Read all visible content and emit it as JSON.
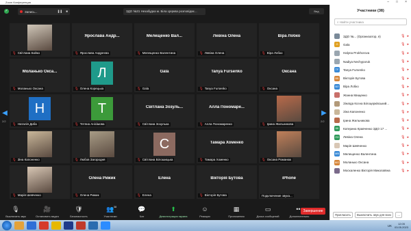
{
  "window": {
    "title": "Zoom Конференция"
  },
  "recording": {
    "label": "Запись...",
    "pause": "❚❚",
    "stop": "■"
  },
  "meeting_title": "ЗДО №31 Незабудка м. Біла Церква розповідає...",
  "view_label": "Вид",
  "pager": {
    "left_page": "2/2",
    "right_page": "2/2"
  },
  "tiles": [
    {
      "name": "",
      "label": "Світлана Бойко",
      "kind": "photo",
      "color": "#cfc6b8"
    },
    {
      "name": "Ярослава Андр...",
      "label": "Ярослава Андреєва",
      "kind": "name"
    },
    {
      "name": "Мелещенко Вал...",
      "label": "Мелещенко Валентина",
      "kind": "name"
    },
    {
      "name": "Левіна Олена",
      "label": "Левіна Олена",
      "kind": "name"
    },
    {
      "name": "Віра Лобко",
      "label": "Віра Лобко",
      "kind": "name"
    },
    {
      "name": "Моланько Окса...",
      "label": "Моланько Оксана",
      "kind": "name"
    },
    {
      "name": "",
      "label": "Олена Корецька",
      "kind": "avatar",
      "letter": "Л",
      "color": "#1f9a8a"
    },
    {
      "name": "Gala",
      "label": "Gala",
      "kind": "name"
    },
    {
      "name": "Tanya Fursenko",
      "label": "Tanya Fursenko",
      "kind": "name"
    },
    {
      "name": "Оксана",
      "label": "Оксана",
      "kind": "name"
    },
    {
      "name": "",
      "label": "Наталія Диба",
      "kind": "avatar",
      "letter": "Н",
      "color": "#1f6fc4"
    },
    {
      "name": "",
      "label": "Тетяна Анісімова",
      "kind": "avatar",
      "letter": "Т",
      "color": "#3c9a3a"
    },
    {
      "name": "Світлана Зозуль...",
      "label": "Світлана Зозулька",
      "kind": "name"
    },
    {
      "name": "Алла Пономаре...",
      "label": "Алла Пономаренко",
      "kind": "name"
    },
    {
      "name": "",
      "label": "Ірина Жильникова",
      "kind": "photo",
      "color": "#b86a4a"
    },
    {
      "name": "",
      "label": "Зіна Капоненко",
      "kind": "photo",
      "color": "#c9b79a"
    },
    {
      "name": "",
      "label": "Любов Загородня",
      "kind": "photo",
      "color": "#a89c86"
    },
    {
      "name": "",
      "label": "Світлана Білошицька",
      "kind": "avatar",
      "letter": "С",
      "color": "#8c6a60"
    },
    {
      "name": "Тамара Хоменко",
      "label": "Тамара Хоменко",
      "kind": "name"
    },
    {
      "name": "",
      "label": "Оксана Романюк",
      "kind": "photo",
      "color": "#c0805a"
    },
    {
      "name": "",
      "label": "Марія Шевченко",
      "kind": "photo",
      "color": "#d8c7b5"
    },
    {
      "name": "Олена Рижик",
      "label": "Олена Рижик",
      "kind": "name"
    },
    {
      "name": "Елена",
      "label": "Елена",
      "kind": "name"
    },
    {
      "name": "Вікторія Бутова",
      "label": "Вікторія Бутова",
      "kind": "name"
    },
    {
      "name": "iPhone",
      "label": "Подключение звука...",
      "kind": "name",
      "nomic": true
    }
  ],
  "toolbar": {
    "items": [
      {
        "label": "Выключить звук",
        "icon": "🎙",
        "name": "mute-button"
      },
      {
        "label": "Остановить видео",
        "icon": "🎥",
        "name": "stop-video-button"
      },
      {
        "label": "Безопасность",
        "icon": "🛡",
        "name": "security-button"
      },
      {
        "label": "Участники",
        "icon": "👥",
        "name": "participants-button",
        "badge": "38"
      },
      {
        "label": "Чат",
        "icon": "💬",
        "name": "chat-button"
      },
      {
        "label": "Демонстрация экрана",
        "icon": "⬆",
        "name": "share-screen-button",
        "green": true
      },
      {
        "label": "Реакции",
        "icon": "☺",
        "name": "reactions-button"
      },
      {
        "label": "Приложения",
        "icon": "▦",
        "name": "apps-button"
      },
      {
        "label": "Доска сообщений",
        "icon": "▭",
        "name": "whiteboard-button"
      },
      {
        "label": "Дополнительно",
        "icon": "•••",
        "name": "more-button"
      }
    ],
    "end_label": "Завершение"
  },
  "panel": {
    "title": "Участники (38)",
    "search_placeholder": "Найти участника",
    "participants": [
      {
        "name": "ЗДО №... (Организатор, я)",
        "initials": "",
        "color": "#7a8a99"
      },
      {
        "name": "Gala",
        "initials": "G",
        "color": "#e0a020"
      },
      {
        "name": "Halyna Prokhorova",
        "initials": "",
        "color": "#9aa6b0"
      },
      {
        "name": "Nadiya Nechyporuk",
        "initials": "",
        "color": "#9aa6b0"
      },
      {
        "name": "Tanya Fursenko",
        "initials": "TF",
        "color": "#3a8ad6"
      },
      {
        "name": "Вікторія Бутова",
        "initials": "ВБ",
        "color": "#d6863a"
      },
      {
        "name": "Віра Лобко",
        "initials": "ВЛ",
        "color": "#3a8ad6"
      },
      {
        "name": "Жанна Мищенко",
        "initials": "",
        "color": "#c9706a"
      },
      {
        "name": "Зінаїда Ксєна Білоцерківський...",
        "initials": "",
        "color": "#b39a7a"
      },
      {
        "name": "Зіна Капоненко",
        "initials": "",
        "color": "#c9b79a"
      },
      {
        "name": "Ірина Жильникова",
        "initials": "",
        "color": "#b86a4a"
      },
      {
        "name": "Катерина Кравченко ЗДО 17 ...",
        "initials": "КК",
        "color": "#2f9a5a"
      },
      {
        "name": "Левіна Олена",
        "initials": "ЛО",
        "color": "#2f9a5a"
      },
      {
        "name": "Марія Шевченко",
        "initials": "",
        "color": "#d8c7b5"
      },
      {
        "name": "Мелещенко Валентина",
        "initials": "МВ",
        "color": "#3a8ad6"
      },
      {
        "name": "Моланько Оксана",
        "initials": "МО",
        "color": "#d6863a"
      },
      {
        "name": "Москаленко Вікторія Миколаївна",
        "initials": "",
        "color": "#7a6a8a"
      }
    ],
    "invite_label": "Пригласить",
    "mute_all_label": "Выключить звук для всех",
    "more_label": "..."
  },
  "taskbar": {
    "lang": "UK",
    "time": "12:05",
    "date": "03.05.2023"
  }
}
